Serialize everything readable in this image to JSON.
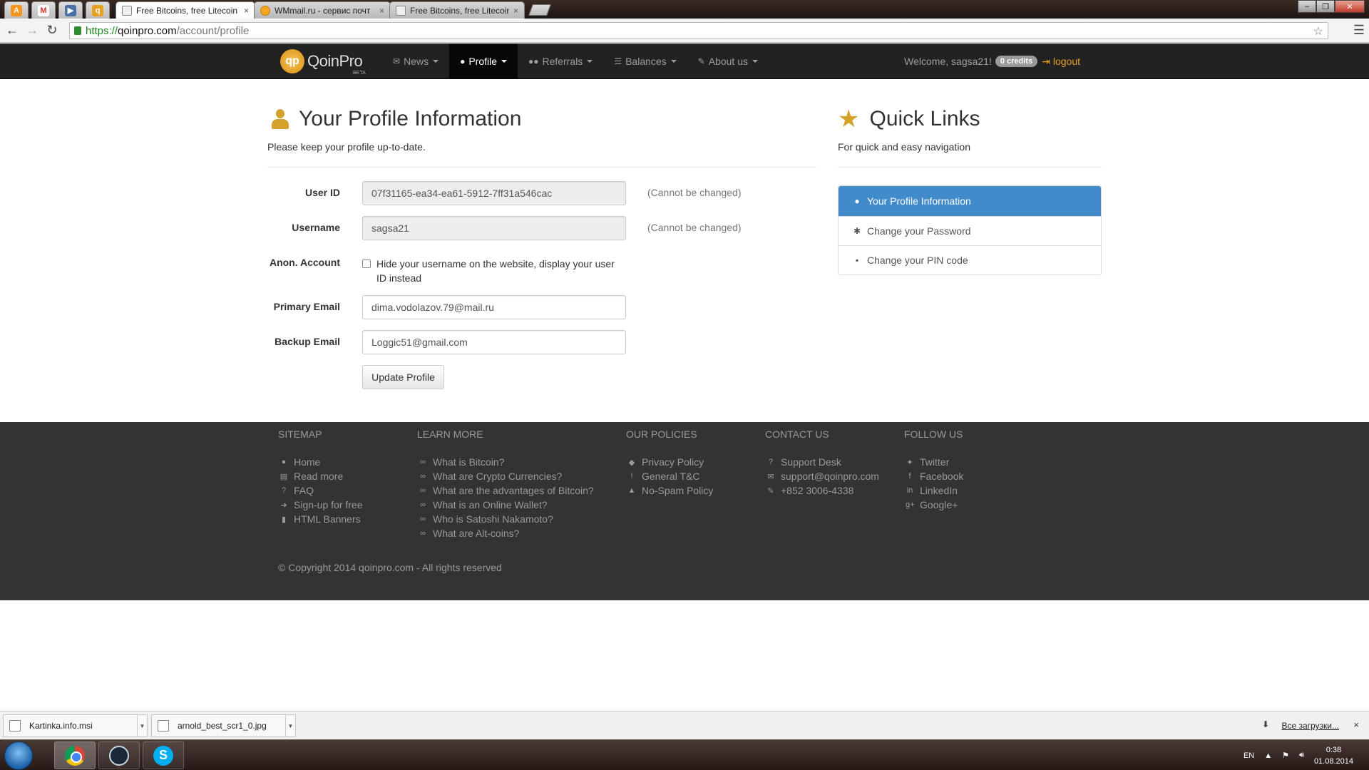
{
  "browser": {
    "pinned_tabs": [
      {
        "icon": "avast-icon",
        "glyph": "A",
        "color": "#f7941d"
      },
      {
        "icon": "gmail-icon",
        "glyph": "M",
        "color": "#d93025"
      },
      {
        "icon": "video-icon",
        "glyph": "▶",
        "color": "#4a6fa5"
      },
      {
        "icon": "qoinpro-icon",
        "glyph": "q",
        "color": "#e5a020"
      }
    ],
    "tabs": [
      {
        "label": "Free Bitcoins, free Litecoin",
        "active": true
      },
      {
        "label": "WMmail.ru - сервис почт",
        "active": false
      },
      {
        "label": "Free Bitcoins, free Litecoin",
        "active": false
      }
    ],
    "tab_close": "×",
    "url_scheme": "https://",
    "url_host": "qoinpro.com",
    "url_path": "/account/profile"
  },
  "navbar": {
    "brand": "QoinPro",
    "brand_logo": "qp",
    "brand_beta": "BETA",
    "items": [
      {
        "label": "News",
        "icon": "envelope-icon",
        "glyph": "✉"
      },
      {
        "label": "Profile",
        "icon": "user-icon",
        "glyph": "●"
      },
      {
        "label": "Referrals",
        "icon": "users-icon",
        "glyph": "●●"
      },
      {
        "label": "Balances",
        "icon": "list-icon",
        "glyph": "☰"
      },
      {
        "label": "About us",
        "icon": "wrench-icon",
        "glyph": "✎"
      }
    ],
    "welcome": "Welcome, sagsa21!",
    "credits": "0 credits",
    "logout": "logout"
  },
  "profile": {
    "title": "Your Profile Information",
    "subtitle": "Please keep your profile up-to-date.",
    "user_id_label": "User ID",
    "user_id_value": "07f31165-ea34-ea61-5912-7ff31a546cac",
    "username_label": "Username",
    "username_value": "sagsa21",
    "cannot_change": "(Cannot be changed)",
    "anon_label": "Anon. Account",
    "anon_text": "Hide your username on the website, display your user ID instead",
    "anon_checked": false,
    "primary_email_label": "Primary Email",
    "primary_email_value": "dima.vodolazov.79@mail.ru",
    "backup_email_label": "Backup Email",
    "backup_email_value": "Loggic51@gmail.com",
    "update_button": "Update Profile"
  },
  "quick_links": {
    "title": "Quick Links",
    "subtitle": "For quick and easy navigation",
    "items": [
      {
        "label": "Your Profile Information",
        "icon": "user-icon",
        "glyph": "●",
        "active": true
      },
      {
        "label": "Change your Password",
        "icon": "asterisk-icon",
        "glyph": "✱",
        "active": false
      },
      {
        "label": "Change your PIN code",
        "icon": "lock-icon",
        "glyph": "▪",
        "active": false
      }
    ]
  },
  "footer": {
    "columns": [
      {
        "heading": "SITEMAP",
        "links": [
          {
            "label": "Home",
            "icon": "globe-icon",
            "glyph": "●"
          },
          {
            "label": "Read more",
            "icon": "book-icon",
            "glyph": "▤"
          },
          {
            "label": "FAQ",
            "icon": "question-icon",
            "glyph": "?"
          },
          {
            "label": "Sign-up for free",
            "icon": "sign-in-icon",
            "glyph": "➔"
          },
          {
            "label": "HTML Banners",
            "icon": "bookmark-icon",
            "glyph": "▮"
          }
        ]
      },
      {
        "heading": "LEARN MORE",
        "links": [
          {
            "label": "What is Bitcoin?",
            "icon": "link-icon",
            "glyph": "∞"
          },
          {
            "label": "What are Crypto Currencies?",
            "icon": "link-icon",
            "glyph": "∞"
          },
          {
            "label": "What are the advantages of Bitcoin?",
            "icon": "link-icon",
            "glyph": "∞"
          },
          {
            "label": "What is an Online Wallet?",
            "icon": "link-icon",
            "glyph": "∞"
          },
          {
            "label": "Who is Satoshi Nakamoto?",
            "icon": "link-icon",
            "glyph": "∞"
          },
          {
            "label": "What are Alt-coins?",
            "icon": "link-icon",
            "glyph": "∞"
          }
        ]
      },
      {
        "heading": "OUR POLICIES",
        "links": [
          {
            "label": "Privacy Policy",
            "icon": "shield-icon",
            "glyph": "◆"
          },
          {
            "label": "General T&C",
            "icon": "info-icon",
            "glyph": "!"
          },
          {
            "label": "No-Spam Policy",
            "icon": "warning-icon",
            "glyph": "▲"
          }
        ]
      },
      {
        "heading": "CONTACT US",
        "links": [
          {
            "label": "Support Desk",
            "icon": "question-circle-icon",
            "glyph": "?"
          },
          {
            "label": "support@qoinpro.com",
            "icon": "envelope-icon",
            "glyph": "✉"
          },
          {
            "label": "+852 3006-4338",
            "icon": "pencil-icon",
            "glyph": "✎"
          }
        ]
      },
      {
        "heading": "FOLLOW US",
        "links": [
          {
            "label": "Twitter",
            "icon": "twitter-icon",
            "glyph": "✦"
          },
          {
            "label": "Facebook",
            "icon": "facebook-icon",
            "glyph": "f"
          },
          {
            "label": "LinkedIn",
            "icon": "linkedin-icon",
            "glyph": "in"
          },
          {
            "label": "Google+",
            "icon": "google-plus-icon",
            "glyph": "g+"
          }
        ]
      }
    ],
    "copyright": "© Copyright 2014 qoinpro.com - All rights reserved"
  },
  "downloads": {
    "items": [
      {
        "name": "Kartinka.info.msi"
      },
      {
        "name": "arnold_best_scr1_0.jpg"
      }
    ],
    "show_all": "Все загрузки...",
    "close": "×"
  },
  "taskbar": {
    "lang": "EN",
    "time": "0:38",
    "date": "01.08.2014"
  }
}
